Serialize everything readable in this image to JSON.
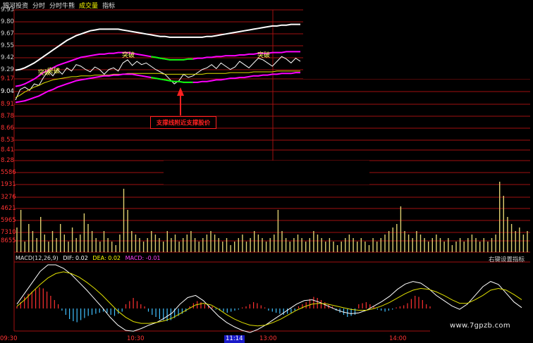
{
  "topbar": {
    "items": [
      "银河投资",
      "分时",
      "分时牛熊",
      "成交量",
      "指标"
    ],
    "active_index": 3
  },
  "annotation": {
    "text": "支撑线附近支撑股价"
  },
  "macd_header": {
    "name": "MACD(12,26,9)",
    "dif": "DIF: 0.02",
    "dea": "DEA: 0.02",
    "macd": "MACD: -0.01"
  },
  "right_hint": "右键设置指标",
  "watermark": "www.7gpzb.com",
  "colors": {
    "price": "#ffffff",
    "avg": "#e0e000",
    "upper_band": "#ff00ff",
    "lower_band": "#ff00ff",
    "band_green": "#00ff00",
    "grid": "#a01010",
    "volume": "#e0d070",
    "macd_pos": "#ff3030",
    "macd_neg": "#40c0ff",
    "dif": "#ffffff",
    "dea": "#e0e000"
  },
  "chart_data": [
    {
      "type": "line",
      "title": "",
      "ylim": [
        8.85,
        9.9
      ],
      "y_ticks": [
        "9.93",
        "9.80",
        "9.67",
        "9.55",
        "9.42",
        "9.29",
        "9.17",
        "9.04",
        "8.91",
        "8.78",
        "8.66",
        "8.53",
        "8.41",
        "8.28"
      ],
      "x_ticks": [
        "09:30",
        "10:30",
        "11:14",
        "13:00",
        "14:00"
      ],
      "labels": [
        "突破",
        "突破",
        "突破",
        "突破"
      ],
      "series": [
        {
          "values": [
            8.92,
            9.05,
            9.08,
            9.04,
            9.12,
            9.1,
            9.2,
            9.28,
            9.22,
            9.3,
            9.24,
            9.32,
            9.28,
            9.36,
            9.34,
            9.3,
            9.27,
            9.33,
            9.3,
            9.24,
            9.3,
            9.32,
            9.28,
            9.38,
            9.42,
            9.35,
            9.4,
            9.36,
            9.38,
            9.34,
            9.3,
            9.27,
            9.24,
            9.18,
            9.12,
            9.16,
            9.24,
            9.2,
            9.22,
            9.26,
            9.3,
            9.32,
            9.36,
            9.31,
            9.38,
            9.34,
            9.3,
            9.33,
            9.4,
            9.36,
            9.32,
            9.38,
            9.44,
            9.42,
            9.38,
            9.34,
            9.4,
            9.46,
            9.43,
            9.38,
            9.44,
            9.4
          ]
        },
        {
          "values": [
            8.95,
            8.98,
            9.02,
            9.05,
            9.08,
            9.1,
            9.13,
            9.15,
            9.17,
            9.18,
            9.19,
            9.2,
            9.21,
            9.21,
            9.22,
            9.22,
            9.22,
            9.23,
            9.23,
            9.23,
            9.23,
            9.24,
            9.24,
            9.24,
            9.25,
            9.25,
            9.25,
            9.25,
            9.25,
            9.25,
            9.25,
            9.25,
            9.24,
            9.24,
            9.24,
            9.24,
            9.24,
            9.24,
            9.24,
            9.24,
            9.24,
            9.25,
            9.25,
            9.25,
            9.25,
            9.25,
            9.26,
            9.26,
            9.26,
            9.26,
            9.26,
            9.27,
            9.27,
            9.27,
            9.27,
            9.27,
            9.28,
            9.28,
            9.28,
            9.28,
            9.28,
            9.28
          ]
        },
        {
          "values": [
            9.29,
            9.3,
            9.32,
            9.35,
            9.38,
            9.42,
            9.46,
            9.5,
            9.54,
            9.58,
            9.62,
            9.66,
            9.69,
            9.72,
            9.74,
            9.76,
            9.78,
            9.79,
            9.8,
            9.8,
            9.8,
            9.8,
            9.8,
            9.79,
            9.78,
            9.77,
            9.76,
            9.75,
            9.74,
            9.73,
            9.72,
            9.71,
            9.71,
            9.7,
            9.7,
            9.7,
            9.7,
            9.7,
            9.7,
            9.7,
            9.7,
            9.71,
            9.71,
            9.72,
            9.73,
            9.74,
            9.75,
            9.76,
            9.77,
            9.78,
            9.79,
            9.8,
            9.81,
            9.82,
            9.83,
            9.84,
            9.84,
            9.85,
            9.85,
            9.86,
            9.86,
            9.86
          ]
        },
        {
          "values": [
            9.09,
            9.1,
            9.12,
            9.15,
            9.18,
            9.22,
            9.26,
            9.29,
            9.32,
            9.35,
            9.37,
            9.39,
            9.41,
            9.43,
            9.45,
            9.46,
            9.47,
            9.48,
            9.49,
            9.49,
            9.5,
            9.5,
            9.51,
            9.51,
            9.51,
            9.5,
            9.49,
            9.48,
            9.47,
            9.46,
            9.45,
            9.44,
            9.43,
            9.42,
            9.42,
            9.42,
            9.42,
            9.43,
            9.43,
            9.44,
            9.44,
            9.45,
            9.45,
            9.46,
            9.46,
            9.47,
            9.47,
            9.47,
            9.48,
            9.48,
            9.49,
            9.49,
            9.5,
            9.5,
            9.5,
            9.51,
            9.51,
            9.51,
            9.52,
            9.52,
            9.52,
            9.52
          ]
        },
        {
          "values": [
            8.89,
            8.9,
            8.91,
            8.93,
            8.95,
            8.97,
            9.0,
            9.03,
            9.05,
            9.08,
            9.1,
            9.12,
            9.14,
            9.16,
            9.17,
            9.18,
            9.19,
            9.2,
            9.21,
            9.22,
            9.22,
            9.23,
            9.23,
            9.24,
            9.24,
            9.24,
            9.23,
            9.22,
            9.21,
            9.2,
            9.19,
            9.18,
            9.17,
            9.16,
            9.15,
            9.15,
            9.14,
            9.14,
            9.14,
            9.14,
            9.15,
            9.15,
            9.16,
            9.17,
            9.17,
            9.18,
            9.19,
            9.19,
            9.2,
            9.2,
            9.21,
            9.22,
            9.22,
            9.23,
            9.23,
            9.24,
            9.24,
            9.25,
            9.25,
            9.25,
            9.26,
            9.26
          ]
        }
      ]
    },
    {
      "type": "bar",
      "title": "",
      "y_ticks": [
        "5586",
        "1931",
        "3276",
        "4621",
        "5965",
        "7310",
        "8655"
      ],
      "ylim": [
        0,
        1
      ],
      "values": [
        0.35,
        0.6,
        0.15,
        0.4,
        0.3,
        0.2,
        0.5,
        0.25,
        0.15,
        0.3,
        0.2,
        0.4,
        0.25,
        0.15,
        0.35,
        0.2,
        0.25,
        0.55,
        0.4,
        0.3,
        0.2,
        0.15,
        0.3,
        0.2,
        0.15,
        0.1,
        0.25,
        0.9,
        0.6,
        0.3,
        0.25,
        0.2,
        0.15,
        0.2,
        0.3,
        0.25,
        0.2,
        0.15,
        0.3,
        0.2,
        0.25,
        0.15,
        0.2,
        0.25,
        0.3,
        0.2,
        0.15,
        0.2,
        0.25,
        0.3,
        0.25,
        0.2,
        0.15,
        0.2,
        0.1,
        0.15,
        0.2,
        0.25,
        0.15,
        0.2,
        0.3,
        0.25,
        0.2,
        0.15,
        0.2,
        0.25,
        0.6,
        0.3,
        0.2,
        0.15,
        0.2,
        0.25,
        0.2,
        0.15,
        0.2,
        0.3,
        0.25,
        0.2,
        0.15,
        0.2,
        0.15,
        0.1,
        0.15,
        0.2,
        0.25,
        0.2,
        0.15,
        0.2,
        0.15,
        0.1,
        0.2,
        0.15,
        0.2,
        0.25,
        0.3,
        0.35,
        0.4,
        0.65,
        0.3,
        0.25,
        0.2,
        0.3,
        0.25,
        0.2,
        0.15,
        0.2,
        0.25,
        0.2,
        0.15,
        0.2,
        0.1,
        0.15,
        0.2,
        0.15,
        0.2,
        0.25,
        0.2,
        0.15,
        0.2,
        0.15,
        0.2,
        0.25,
        1.0,
        0.8,
        0.5,
        0.4,
        0.3,
        0.35,
        0.25,
        0.3
      ]
    },
    {
      "type": "bar",
      "title": "",
      "values": [
        0.1,
        0.3,
        0.55,
        0.7,
        0.8,
        0.9,
        1.0,
        0.95,
        0.8,
        0.6,
        0.4,
        0.2,
        -0.1,
        -0.3,
        -0.5,
        -0.6,
        -0.65,
        -0.55,
        -0.45,
        -0.35,
        -0.3,
        -0.25,
        -0.2,
        -0.15,
        -0.2,
        -0.3,
        -0.35,
        -0.25,
        -0.15,
        0.2,
        0.35,
        0.5,
        0.35,
        0.2,
        0.1,
        -0.15,
        -0.3,
        -0.4,
        -0.5,
        -0.55,
        -0.6,
        -0.55,
        -0.45,
        -0.35,
        -0.25,
        -0.15,
        0.1,
        0.25,
        0.35,
        0.3,
        0.2,
        0.15,
        0.1,
        -0.05,
        -0.1,
        -0.15,
        -0.2,
        -0.15,
        -0.1,
        -0.05,
        0.05,
        0.1,
        0.2,
        0.3,
        0.25,
        0.15,
        0.05,
        -0.1,
        -0.15,
        -0.2,
        -0.25,
        -0.3,
        -0.25,
        -0.2,
        -0.1,
        0.1,
        0.2,
        0.3,
        0.45,
        0.55,
        0.5,
        0.4,
        0.3,
        0.2,
        0.1,
        -0.1,
        -0.2,
        -0.3,
        -0.4,
        -0.35,
        -0.3,
        0.2,
        0.25,
        0.3,
        0.2,
        0.1,
        -0.05,
        -0.1,
        -0.15,
        -0.1,
        -0.05,
        0.05,
        0.1,
        0.15,
        0.25,
        0.45,
        0.6,
        0.55,
        0.4,
        0.2,
        0.1
      ],
      "series": [
        {
          "values": [
            0.1,
            0.35,
            0.6,
            0.85,
            1.0,
            1.0,
            0.92,
            0.78,
            0.6,
            0.42,
            0.22,
            0.02,
            -0.2,
            -0.38,
            -0.5,
            -0.52,
            -0.46,
            -0.38,
            -0.32,
            -0.22,
            -0.1,
            0.1,
            0.25,
            0.3,
            0.18,
            0.0,
            -0.18,
            -0.32,
            -0.42,
            -0.5,
            -0.55,
            -0.48,
            -0.38,
            -0.26,
            -0.14,
            -0.02,
            0.1,
            0.18,
            0.2,
            0.14,
            0.06,
            -0.02,
            -0.08,
            -0.12,
            -0.1,
            -0.04,
            0.06,
            0.16,
            0.28,
            0.44,
            0.56,
            0.62,
            0.58,
            0.46,
            0.3,
            0.18,
            0.06,
            -0.02,
            0.1,
            0.3,
            0.5,
            0.62,
            0.55,
            0.35,
            0.15,
            0.02
          ]
        },
        {
          "values": [
            0.05,
            0.2,
            0.38,
            0.55,
            0.7,
            0.8,
            0.84,
            0.8,
            0.72,
            0.6,
            0.46,
            0.3,
            0.12,
            -0.06,
            -0.2,
            -0.3,
            -0.34,
            -0.34,
            -0.32,
            -0.28,
            -0.22,
            -0.12,
            -0.02,
            0.08,
            0.12,
            0.08,
            -0.02,
            -0.14,
            -0.24,
            -0.32,
            -0.38,
            -0.4,
            -0.38,
            -0.32,
            -0.24,
            -0.14,
            -0.04,
            0.04,
            0.1,
            0.12,
            0.1,
            0.06,
            0.02,
            -0.02,
            -0.04,
            -0.04,
            0.0,
            0.06,
            0.14,
            0.24,
            0.34,
            0.42,
            0.46,
            0.44,
            0.38,
            0.3,
            0.2,
            0.12,
            0.12,
            0.2,
            0.3,
            0.42,
            0.46,
            0.42,
            0.32,
            0.2
          ]
        }
      ]
    }
  ]
}
